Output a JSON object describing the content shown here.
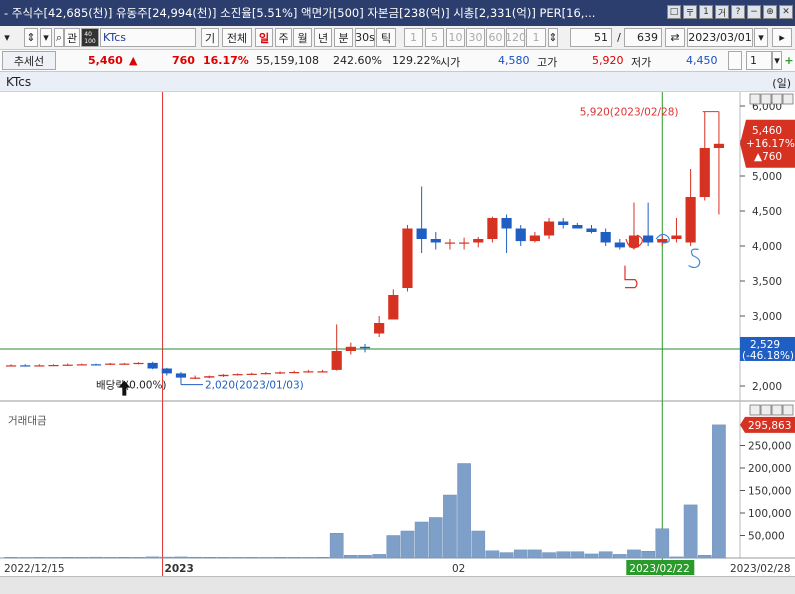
{
  "header": {
    "info": "- 주식수[42,685(천)] 유동주[24,994(천)] 소진율[5.51%] 액면가[500] 자본금[238(억)] 시총[2,331(억)] PER[16,...",
    "win_buttons": [
      "□",
      "〒",
      "1",
      "거",
      "?",
      "−",
      "⊕",
      "✕"
    ]
  },
  "toolbar": {
    "code_label": "관",
    "code_small": "40\n100",
    "search_value": "KTcs",
    "btn_gi": "기",
    "btn_all": "전체",
    "periods": [
      "일",
      "주",
      "월",
      "년",
      "분",
      "30s",
      "틱"
    ],
    "active_period": "일",
    "nums": [
      "1",
      "5",
      "10",
      "30",
      "60",
      "120"
    ],
    "spin_value": "1",
    "count_current": "51",
    "count_sep": "/",
    "count_total": "639",
    "date_value": "2023/03/01"
  },
  "quote": {
    "trend_label": "추세선",
    "price": "5,460",
    "arrow": "▲",
    "change": "760",
    "change_pct": "16.17%",
    "volume": "55,159,108",
    "ratio1": "242.60%",
    "ratio2": "129.22%",
    "open_label": "시가",
    "open": "4,580",
    "high_label": "고가",
    "high": "5,920",
    "low_label": "저가",
    "low": "4,450",
    "spin": "1"
  },
  "chart_title": "KTcs",
  "unit_label": "(일)",
  "colors": {
    "up": "#d63221",
    "down": "#1f5fc4",
    "volume": "#7ea0c8",
    "annotation_red": "#e03030",
    "annotation_blue": "#3a8ad8"
  },
  "chart_data": [
    {
      "type": "candlestick",
      "title": "KTcs",
      "x": [
        "12/15",
        "12/16",
        "12/19",
        "12/20",
        "12/21",
        "12/22",
        "12/23",
        "12/26",
        "12/27",
        "12/28",
        "12/29",
        "01/02",
        "01/03",
        "01/04",
        "01/05",
        "01/06",
        "01/09",
        "01/10",
        "01/11",
        "01/12",
        "01/13",
        "01/16",
        "01/17",
        "01/18",
        "01/19",
        "01/20",
        "01/25",
        "01/26",
        "01/27",
        "01/30",
        "01/31",
        "02/01",
        "02/02",
        "02/03",
        "02/06",
        "02/07",
        "02/08",
        "02/09",
        "02/10",
        "02/13",
        "02/14",
        "02/15",
        "02/16",
        "02/17",
        "02/20",
        "02/21",
        "02/22",
        "02/23",
        "02/24",
        "02/27",
        "02/28"
      ],
      "open": [
        2290,
        2295,
        2290,
        2295,
        2300,
        2305,
        2310,
        2310,
        2320,
        2320,
        2330,
        2250,
        2180,
        2120,
        2120,
        2140,
        2160,
        2170,
        2175,
        2185,
        2195,
        2200,
        2210,
        2230,
        2500,
        2560,
        2750,
        2950,
        3400,
        4250,
        4100,
        4050,
        4050,
        4050,
        4100,
        4400,
        4250,
        4070,
        4150,
        4350,
        4300,
        4250,
        4200,
        4050,
        3980,
        4150,
        4050,
        4100,
        4050,
        4700,
        5400
      ],
      "close": [
        2295,
        2290,
        2295,
        2300,
        2305,
        2310,
        2305,
        2320,
        2320,
        2330,
        2250,
        2180,
        2120,
        2120,
        2140,
        2160,
        2170,
        2175,
        2185,
        2195,
        2200,
        2210,
        2210,
        2500,
        2560,
        2540,
        2900,
        3300,
        4250,
        4100,
        4050,
        4050,
        4050,
        4100,
        4400,
        4250,
        4070,
        4150,
        4350,
        4300,
        4250,
        4200,
        4050,
        3980,
        4150,
        4050,
        4100,
        4150,
        4700,
        5400,
        5460
      ],
      "high": [
        2310,
        2310,
        2310,
        2310,
        2320,
        2320,
        2320,
        2330,
        2330,
        2340,
        2345,
        2260,
        2200,
        2150,
        2150,
        2170,
        2180,
        2190,
        2200,
        2210,
        2220,
        2230,
        2230,
        2880,
        2620,
        2600,
        3000,
        3380,
        4300,
        4850,
        4200,
        4100,
        4120,
        4130,
        4420,
        4450,
        4300,
        4200,
        4400,
        4400,
        4330,
        4300,
        4250,
        4100,
        4620,
        4620,
        4150,
        4400,
        5100,
        5920,
        5920
      ],
      "low": [
        2280,
        2280,
        2280,
        2285,
        2290,
        2295,
        2295,
        2300,
        2310,
        2310,
        2240,
        2150,
        2020,
        2100,
        2110,
        2130,
        2150,
        2160,
        2165,
        2170,
        2185,
        2190,
        2195,
        2220,
        2450,
        2480,
        2700,
        2950,
        3350,
        3900,
        3950,
        3950,
        3950,
        3980,
        4050,
        3900,
        4000,
        4050,
        4100,
        4250,
        4250,
        4180,
        4000,
        3950,
        3950,
        4000,
        4000,
        4050,
        4000,
        4650,
        4450
      ],
      "y_ticks": [
        "6,000",
        "5,500",
        "5,000",
        "4,500",
        "4,000",
        "3,500",
        "3,000",
        "2,500",
        "2,000"
      ],
      "ylim": [
        1800,
        6200
      ],
      "x_tick_labels": [
        "2022/12/15",
        "2023",
        "02",
        "2023/02/22",
        "2023/02/28"
      ],
      "annotations": {
        "high": "5,920(2023/02/28)",
        "low": "2,020(2023/01/03)",
        "dividend": "배당락(0.00%)",
        "current_price": "5,460",
        "current_change": "+16.17%",
        "current_delta": "▲760",
        "ma_value": "2,529",
        "ma_pct": "(-46.18%)",
        "ma_level": 2529
      }
    },
    {
      "type": "bar",
      "title": "거래대금",
      "values": [
        1500,
        1200,
        1400,
        1300,
        1600,
        1500,
        1800,
        1400,
        1700,
        1500,
        2500,
        2000,
        2400,
        1800,
        1600,
        1500,
        1400,
        1500,
        1300,
        1600,
        1500,
        1400,
        1700,
        55000,
        6000,
        6000,
        8000,
        50000,
        60000,
        80000,
        90000,
        140000,
        210000,
        60000,
        16000,
        12000,
        18000,
        18000,
        12000,
        14000,
        14000,
        9000,
        14000,
        8000,
        18000,
        15000,
        65000,
        2500,
        118000,
        6000,
        295863
      ],
      "ylim": [
        0,
        320000
      ],
      "y_ticks": [
        "250,000",
        "200,000",
        "150,000",
        "100,000",
        "50,000"
      ],
      "current_label": "295,863"
    }
  ]
}
